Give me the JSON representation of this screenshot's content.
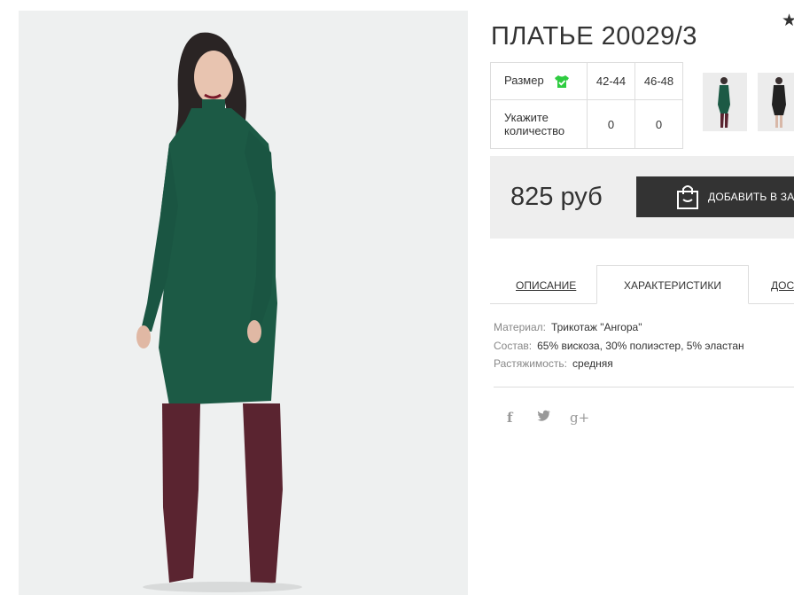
{
  "product": {
    "title": "ПЛАТЬЕ 20029/3",
    "favorite_icon": "star-icon"
  },
  "sizes": {
    "size_label": "Размер",
    "size_icon": "shirt-check-icon",
    "size_icon_color": "#2ecc40",
    "options": [
      "42-44",
      "46-48"
    ],
    "qty_label": "Укажите количество",
    "quantities": [
      "0",
      "0"
    ]
  },
  "purchase": {
    "price": "825 руб",
    "cart_button_label": "ДОБАВИТЬ В ЗА",
    "cart_icon": "shopping-bag-icon"
  },
  "tabs": [
    {
      "label": "ОПИСАНИЕ",
      "active": false
    },
    {
      "label": "ХАРАКТЕРИСТИКИ",
      "active": true
    },
    {
      "label": "ДОС",
      "active": false
    }
  ],
  "specs": [
    {
      "key": "Материал:",
      "value": "Трикотаж \"Ангора\""
    },
    {
      "key": "Состав:",
      "value": "65% вискоза, 30% полиэстер, 5% эластан"
    },
    {
      "key": "Растяжимость:",
      "value": "средняя"
    }
  ],
  "social": [
    {
      "icon": "facebook-icon",
      "glyph": "f"
    },
    {
      "icon": "twitter-icon",
      "glyph": "t"
    },
    {
      "icon": "google-plus-icon",
      "glyph": "g+"
    }
  ],
  "colors": {
    "dress": "#1c5a45",
    "boots": "#5a2430",
    "button": "#333333",
    "price_box": "#eeeeee"
  }
}
